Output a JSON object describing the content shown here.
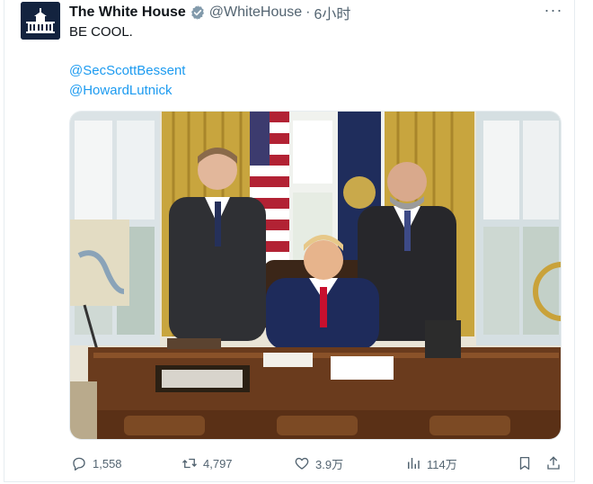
{
  "tweet": {
    "author_name": "The White House",
    "handle": "@WhiteHouse",
    "separator": "·",
    "time": "6小时",
    "text": "BE COOL.",
    "mentions": [
      "@SecScottBessent",
      "@HowardLutnick"
    ],
    "more_label": "···"
  },
  "stats": {
    "replies": "1,558",
    "retweets": "4,797",
    "likes": "3.9万",
    "views": "114万"
  },
  "colors": {
    "link": "#1d9bf0",
    "muted": "#536471",
    "verified_badge": "#829aab"
  },
  "icons": {
    "verified": "verified-badge-icon",
    "more": "more-icon",
    "reply": "reply-icon",
    "retweet": "retweet-icon",
    "like": "heart-icon",
    "views": "views-icon",
    "bookmark": "bookmark-icon",
    "share": "share-icon"
  }
}
